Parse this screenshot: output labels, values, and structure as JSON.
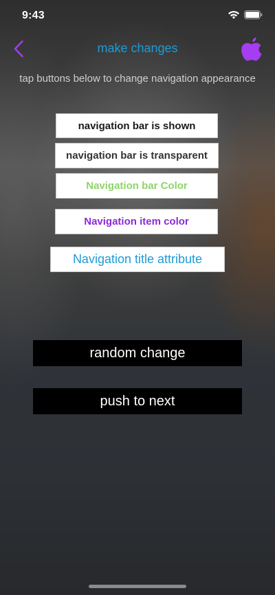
{
  "status_bar": {
    "time": "9:43"
  },
  "nav": {
    "title": "make changes",
    "accent_color": "#a43ef0",
    "title_color": "#1e9bd6"
  },
  "hint": "tap buttons below to change navigation appearance",
  "buttons": {
    "nav_bar_shown": "navigation bar is shown",
    "nav_bar_transparent": "navigation bar is transparent",
    "nav_bar_color": "Navigation bar Color",
    "nav_item_color": "Navigation item color",
    "nav_title_attribute": "Navigation title attribute",
    "random_change": "random change",
    "push_to_next": "push to next"
  },
  "colors": {
    "bar_color_label": "#8fd46b",
    "item_color_label": "#8b2ad6",
    "title_attr_label": "#1e9bd6"
  }
}
